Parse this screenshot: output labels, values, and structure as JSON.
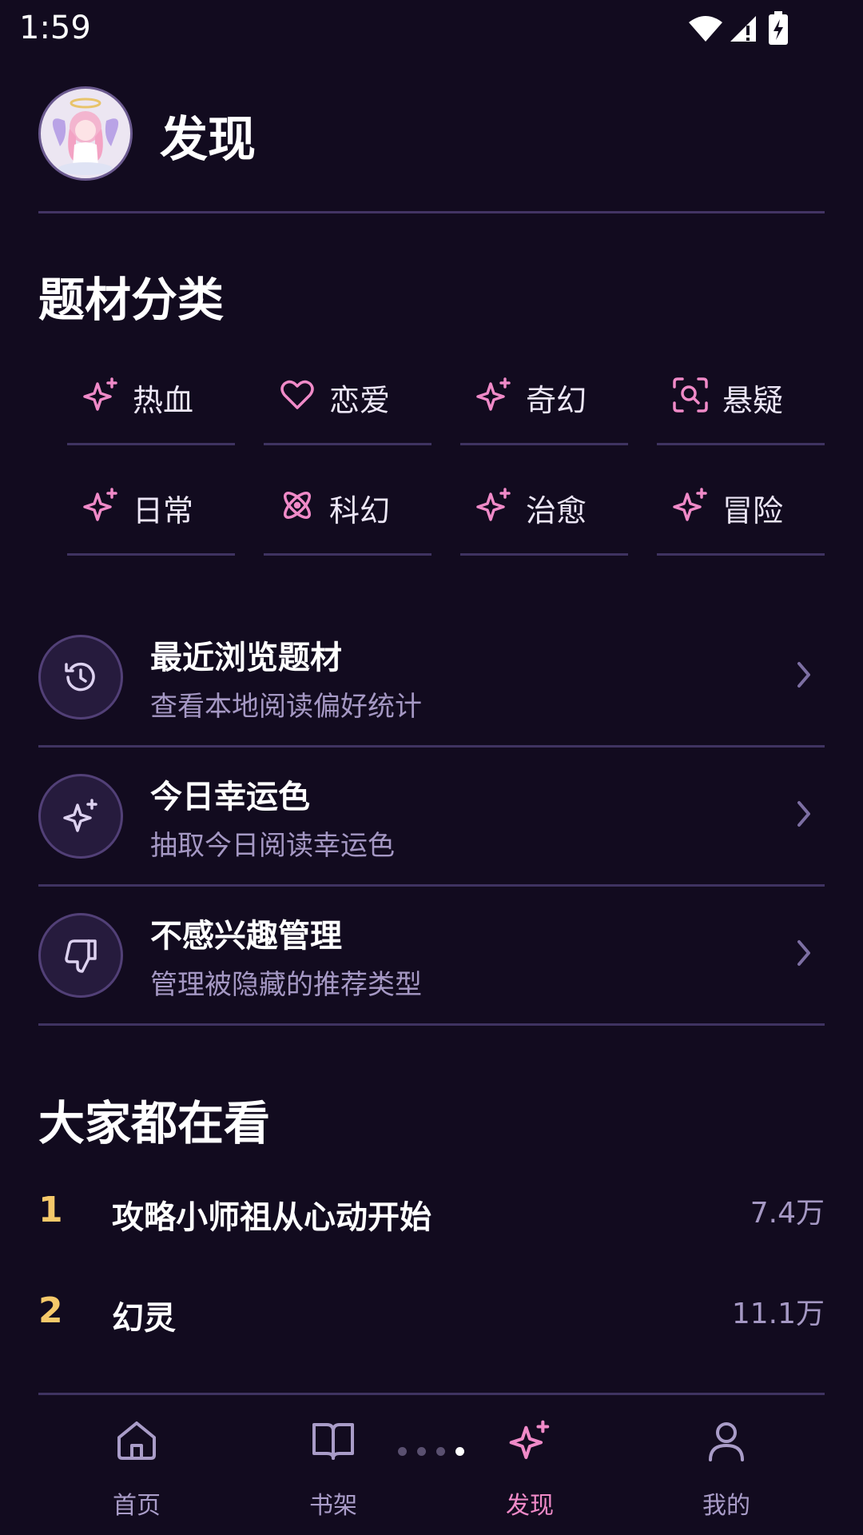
{
  "status_bar": {
    "time": "1:59"
  },
  "header": {
    "title": "发现"
  },
  "categories": {
    "title": "题材分类",
    "items": [
      {
        "label": "热血",
        "icon": "sparkle-icon"
      },
      {
        "label": "恋爱",
        "icon": "heart-icon"
      },
      {
        "label": "奇幻",
        "icon": "sparkle-icon"
      },
      {
        "label": "悬疑",
        "icon": "scan-search-icon"
      },
      {
        "label": "日常",
        "icon": "sparkle-icon"
      },
      {
        "label": "科幻",
        "icon": "atom-icon"
      },
      {
        "label": "治愈",
        "icon": "sparkle-icon"
      },
      {
        "label": "冒险",
        "icon": "sparkle-icon"
      }
    ]
  },
  "menu": [
    {
      "title": "最近浏览题材",
      "subtitle": "查看本地阅读偏好统计",
      "icon": "history-icon"
    },
    {
      "title": "今日幸运色",
      "subtitle": "抽取今日阅读幸运色",
      "icon": "sparkle-icon"
    },
    {
      "title": "不感兴趣管理",
      "subtitle": "管理被隐藏的推荐类型",
      "icon": "thumbs-down-icon"
    }
  ],
  "trending": {
    "title": "大家都在看",
    "items": [
      {
        "rank": "1",
        "title": "攻略小师祖从心动开始",
        "count": "7.4万"
      },
      {
        "rank": "2",
        "title": "幻灵",
        "count": "11.1万"
      }
    ]
  },
  "tabbar": {
    "items": [
      {
        "label": "首页",
        "icon": "home-icon"
      },
      {
        "label": "书架",
        "icon": "book-icon"
      },
      {
        "label": "发现",
        "icon": "sparkle-icon",
        "active": true
      },
      {
        "label": "我的",
        "icon": "user-icon"
      }
    ]
  },
  "colors": {
    "accent": "#f08ac8",
    "rank_number": "#f6c96a",
    "background": "#120b1f",
    "muted_text": "#a598c4"
  }
}
